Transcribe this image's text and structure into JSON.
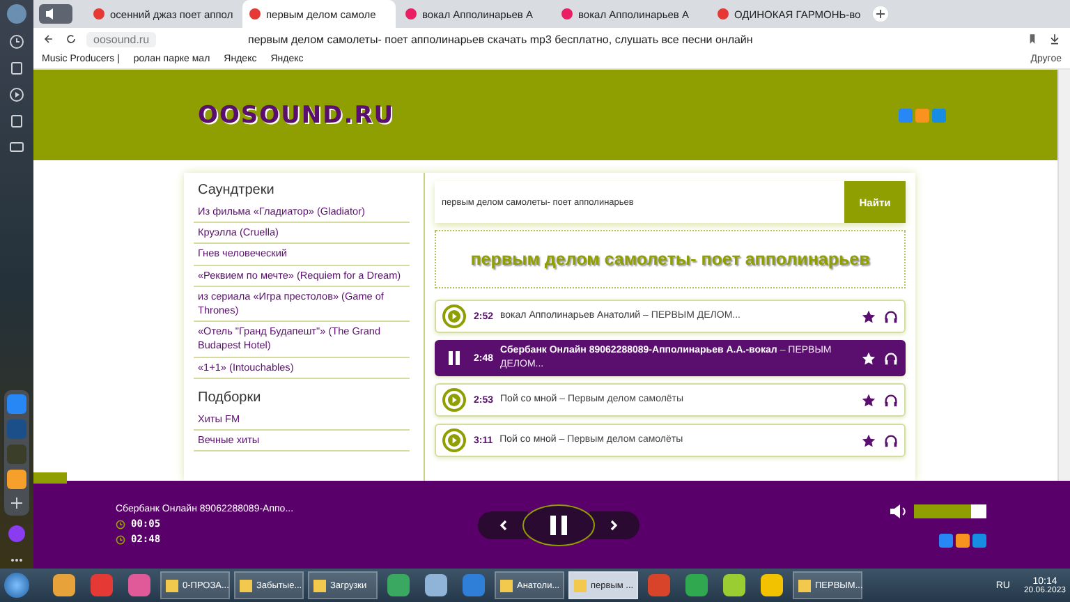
{
  "browser": {
    "tabs": [
      {
        "label": "осенний джаз поет аппол",
        "selected": false,
        "color": "#e53935"
      },
      {
        "label": "первым делом самоле",
        "selected": true,
        "color": "#e53935"
      },
      {
        "label": "вокал Апполинарьев А",
        "selected": false,
        "color": "#e91e63"
      },
      {
        "label": "вокал Апполинарьев А",
        "selected": false,
        "color": "#e91e63"
      },
      {
        "label": "ОДИНОКАЯ ГАРМОНЬ-во",
        "selected": false,
        "color": "#e53935"
      }
    ],
    "address": "oosound.ru",
    "page_title": "первым делом самолеты- поет апполинарьев скачать mp3 бесплатно, слушать все песни онлайн",
    "bookmarks": [
      "Music Producers |",
      "ролан парке мал",
      "Яндекс",
      "Яндекс"
    ],
    "bookmarks_more": "Другое"
  },
  "site": {
    "logo": "OOSOUND.RU",
    "sidebar": [
      {
        "heading": "Саундтреки",
        "items": [
          "Из фильма «Гладиатор» (Gladiator)",
          "Круэлла (Cruella)",
          "Гнев человеческий",
          "«Реквием по мечте» (Requiem for a Dream)",
          "из сериала «Игра престолов» (Game of Thrones)",
          "«Отель \"Гранд Будапешт\"» (The Grand Budapest Hotel)",
          "«1+1» (Intouchables)"
        ]
      },
      {
        "heading": "Подборки",
        "items": [
          "Хиты FM",
          "Вечные хиты"
        ]
      }
    ],
    "search": {
      "value": "первым делом самолеты- поет апполинарьев",
      "button": "Найти"
    },
    "title": "первым делом самолеты- поет апполинарьев",
    "tracks": [
      {
        "time": "2:52",
        "artist": "вокал Апполинарьев Анатолий",
        "title": "– ПЕРВЫМ ДЕЛОМ...",
        "selected": false
      },
      {
        "time": "2:48",
        "artist": "Сбербанк Онлайн 89062288089-Апполинарьев А.А.-вокал",
        "title": "– ПЕРВЫМ ДЕЛОМ...",
        "selected": true
      },
      {
        "time": "2:53",
        "artist": "Пой со мной",
        "title": "– Первым делом самолёты",
        "selected": false
      },
      {
        "time": "3:11",
        "artist": "Пой со мной",
        "title": "– Первым делом самолёты",
        "selected": false
      }
    ]
  },
  "player": {
    "track": "Сбербанк Онлайн 89062288089-Аппо...",
    "elapsed": "00:05",
    "duration": "02:48",
    "volume": {
      "level": 0.78
    }
  },
  "taskbar": {
    "items": [
      {
        "kind": "icon",
        "color": "#e8a23a"
      },
      {
        "kind": "icon",
        "color": "#e53935"
      },
      {
        "kind": "icon",
        "color": "#e05a9a"
      },
      {
        "kind": "window",
        "label": "0-ПРОЗА...",
        "selected": false
      },
      {
        "kind": "window",
        "label": "Забытые...",
        "selected": false
      },
      {
        "kind": "window",
        "label": "Загрузки",
        "selected": false
      },
      {
        "kind": "icon",
        "color": "#3aa860"
      },
      {
        "kind": "icon",
        "color": "#8fb4d8"
      },
      {
        "kind": "icon",
        "color": "#2f7fd8"
      },
      {
        "kind": "window",
        "label": "Анатоли...",
        "selected": false
      },
      {
        "kind": "window",
        "label": "первым ...",
        "selected": true
      },
      {
        "kind": "icon",
        "color": "#d8442a"
      },
      {
        "kind": "icon",
        "color": "#2fa84f"
      },
      {
        "kind": "icon",
        "color": "#9acd32"
      },
      {
        "kind": "icon",
        "color": "#f2c200"
      },
      {
        "kind": "window",
        "label": "ПЕРВЫМ...",
        "selected": false
      }
    ],
    "lang": "RU",
    "time": "10:14",
    "date": "20.06.2023"
  }
}
